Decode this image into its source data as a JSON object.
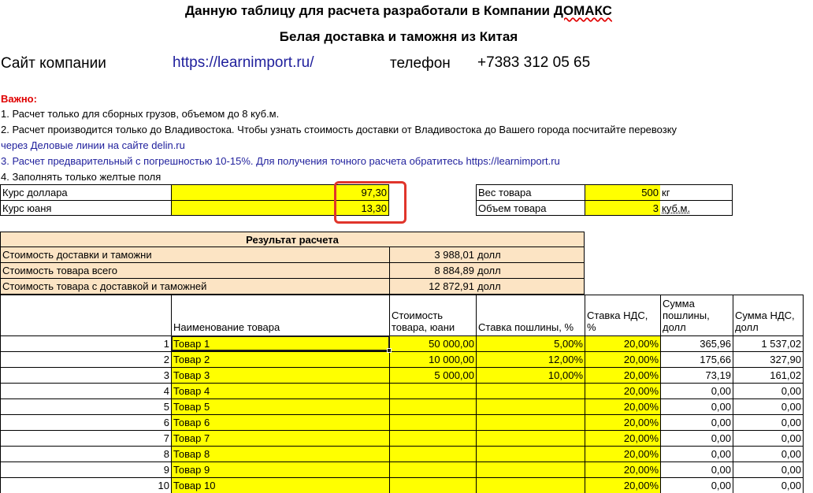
{
  "header": {
    "title_prefix": "Данную таблицу для расчета разработали в Компании ",
    "title_company": "ДОМАКС",
    "subtitle": "Белая доставка и таможня из Китая",
    "site_label": "Сайт компании",
    "site_url": "https://learnimport.ru/",
    "phone_label": "телефон",
    "phone": "+7383 312 05 65"
  },
  "notes": {
    "important": "Важно:",
    "lines": [
      "1. Расчет только для сборных грузов, объемом до 8 куб.м.",
      "2. Расчет производится только до Владивостока. Чтобы узнать стоимость доставки от Владивостока до Вашего города посчитайте перевозку",
      "через Деловые линии на сайте delin.ru",
      "3. Расчет предварительный с погрешностью 10-15%. Для получения точного расчета обратитесь https://learnimport.ru",
      "4. Заполнять только желтые поля"
    ]
  },
  "inputs": {
    "usd_label": "Курс доллара",
    "usd_value": "97,30",
    "cny_label": "Курс юаня",
    "cny_value": "13,30",
    "weight_label": "Вес товара",
    "weight_value": "500",
    "weight_unit": "кг",
    "volume_label": "Объем товара",
    "volume_value": "3",
    "volume_unit": "куб.м."
  },
  "result": {
    "title": "Результат расчета",
    "rows": [
      {
        "label": "Стоимость доставки и таможни",
        "value": "3 988,01",
        "unit": "долл"
      },
      {
        "label": "Стоимость товара всего",
        "value": "8 884,89",
        "unit": "долл"
      },
      {
        "label": "Стоимость товара с доставкой и таможней",
        "value": "12 872,91",
        "unit": "долл"
      }
    ]
  },
  "table": {
    "headers": {
      "name": "Наименование товара",
      "cost": "Стоимость товара, юани",
      "duty_rate": "Ставка пошлины, %",
      "vat_rate": "Ставка НДС, %",
      "duty_sum": "Сумма пошлины, долл",
      "vat_sum": "Сумма НДС, долл"
    },
    "rows": [
      {
        "n": "1",
        "name": "Товар 1",
        "cost": "50 000,00",
        "duty": "5,00%",
        "vat": "20,00%",
        "duty_sum": "365,96",
        "vat_sum": "1 537,02"
      },
      {
        "n": "2",
        "name": "Товар 2",
        "cost": "10 000,00",
        "duty": "12,00%",
        "vat": "20,00%",
        "duty_sum": "175,66",
        "vat_sum": "327,90"
      },
      {
        "n": "3",
        "name": "Товар 3",
        "cost": "5 000,00",
        "duty": "10,00%",
        "vat": "20,00%",
        "duty_sum": "73,19",
        "vat_sum": "161,02"
      },
      {
        "n": "4",
        "name": "Товар 4",
        "cost": "",
        "duty": "",
        "vat": "20,00%",
        "duty_sum": "0,00",
        "vat_sum": "0,00"
      },
      {
        "n": "5",
        "name": "Товар 5",
        "cost": "",
        "duty": "",
        "vat": "20,00%",
        "duty_sum": "0,00",
        "vat_sum": "0,00"
      },
      {
        "n": "6",
        "name": "Товар 6",
        "cost": "",
        "duty": "",
        "vat": "20,00%",
        "duty_sum": "0,00",
        "vat_sum": "0,00"
      },
      {
        "n": "7",
        "name": "Товар 7",
        "cost": "",
        "duty": "",
        "vat": "20,00%",
        "duty_sum": "0,00",
        "vat_sum": "0,00"
      },
      {
        "n": "8",
        "name": "Товар 8",
        "cost": "",
        "duty": "",
        "vat": "20,00%",
        "duty_sum": "0,00",
        "vat_sum": "0,00"
      },
      {
        "n": "9",
        "name": "Товар 9",
        "cost": "",
        "duty": "",
        "vat": "20,00%",
        "duty_sum": "0,00",
        "vat_sum": "0,00"
      },
      {
        "n": "10",
        "name": "Товар 10",
        "cost": "",
        "duty": "",
        "vat": "20,00%",
        "duty_sum": "0,00",
        "vat_sum": "0,00"
      }
    ]
  },
  "colors": {
    "input_fill": "#ffff00",
    "result_fill": "#fce4c4",
    "highlight": "#e0352b",
    "link_blue": "#1f1f9c",
    "important_red": "#e00000"
  }
}
